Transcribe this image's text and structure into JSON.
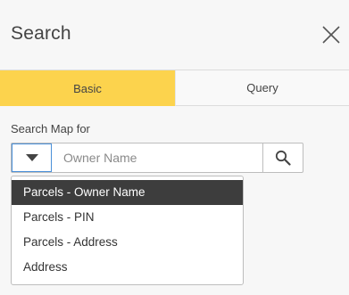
{
  "panel": {
    "title": "Search",
    "close_icon": "close-icon"
  },
  "tabs": [
    {
      "label": "Basic",
      "active": true
    },
    {
      "label": "Query",
      "active": false
    }
  ],
  "search": {
    "label": "Search Map for",
    "placeholder": "Owner Name",
    "value": "",
    "toggle_icon": "caret-down-icon",
    "button_icon": "search-icon"
  },
  "dropdown": {
    "selected_index": 0,
    "options": [
      "Parcels - Owner Name",
      "Parcels - PIN",
      "Parcels - Address",
      "Address"
    ]
  },
  "colors": {
    "active_tab": "#fcd34d",
    "selected_option_bg": "#3d3d3d",
    "focus_border": "#4a90d9"
  }
}
